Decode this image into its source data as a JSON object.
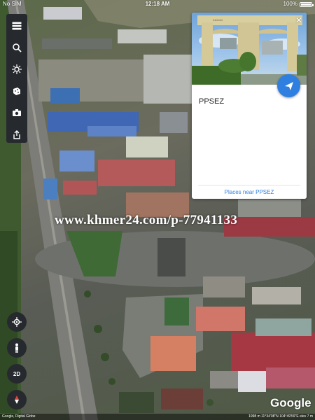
{
  "status_bar": {
    "carrier": "No SIM",
    "time": "12:18 AM",
    "battery": "100%"
  },
  "toolbar": {
    "items": [
      {
        "name": "menu-icon"
      },
      {
        "name": "search-icon"
      },
      {
        "name": "voyager-icon"
      },
      {
        "name": "dice-icon"
      },
      {
        "name": "camera-icon"
      },
      {
        "name": "share-upload-icon"
      }
    ]
  },
  "card": {
    "title": "PPSEZ",
    "places_link": "Places near PPSEZ",
    "close_symbol": "✕"
  },
  "watermark": "www.khmer24.com/p-77941133",
  "controls": {
    "compass": "compass-icon",
    "pegman": "pegman-icon",
    "view_mode": "2D",
    "north": "north-arrow-icon"
  },
  "google_logo": "Google",
  "footer": {
    "left": "Google, Digital Globe",
    "right": "1998 m  11°34'08\"N 104°49'59\"E  elev 7 m"
  },
  "colors": {
    "accent": "#2f7fe0",
    "toolbar_bg": "#262a2e"
  }
}
